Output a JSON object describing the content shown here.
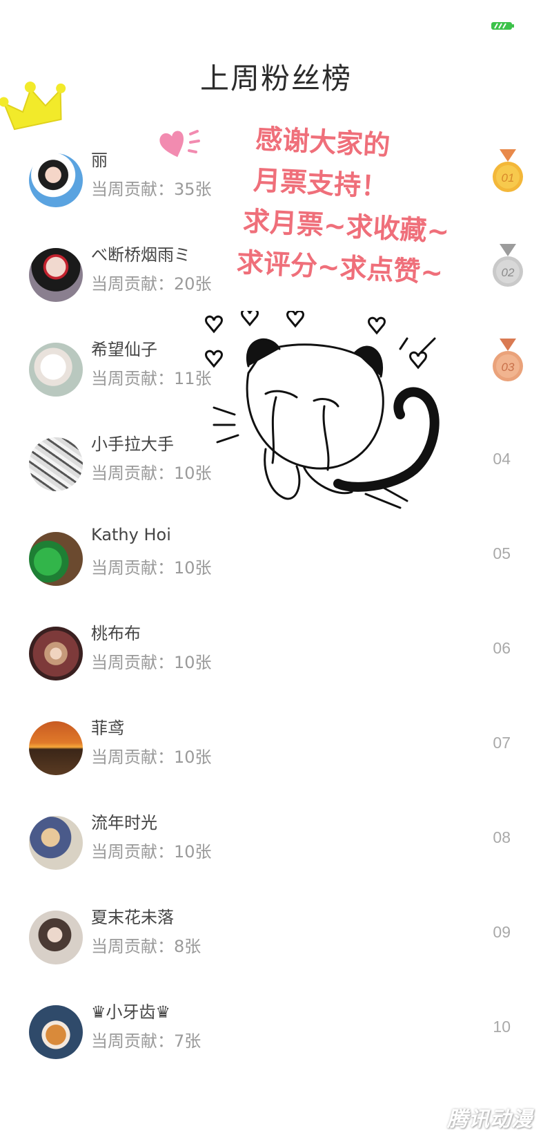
{
  "title": "上周粉丝榜",
  "thanks_message": [
    "感谢大家的",
    "月票支持！",
    "求月票~求收藏~",
    "求评分~求点赞~"
  ],
  "watermark": "腾讯动漫",
  "colors": {
    "accent_pink": "#ef6f7a",
    "gold": "#f3b739",
    "silver": "#c9c9c9",
    "bronze": "#eaa27a"
  },
  "fans": [
    {
      "name": "丽",
      "contribution": "当周贡献：35张",
      "rank": "01",
      "medal": "gold"
    },
    {
      "name": "べ断桥烟雨ミ",
      "contribution": "当周贡献：20张",
      "rank": "02",
      "medal": "silver"
    },
    {
      "name": "希望仙子",
      "contribution": "当周贡献：11张",
      "rank": "03",
      "medal": "bronze"
    },
    {
      "name": " 小手拉大手",
      "contribution": "当周贡献：10张",
      "rank": "04"
    },
    {
      "name": "Kathy Hoi",
      "contribution": "当周贡献：10张",
      "rank": "05"
    },
    {
      "name": "桃布布",
      "contribution": "当周贡献：10张",
      "rank": "06"
    },
    {
      "name": "菲鸢",
      "contribution": "当周贡献：10张",
      "rank": "07"
    },
    {
      "name": "流年时光",
      "contribution": "当周贡献：10张",
      "rank": "08"
    },
    {
      "name": "夏末花未落",
      "contribution": "当周贡献：8张",
      "rank": "09"
    },
    {
      "name": "♛小牙齿♛",
      "contribution": "当周贡献：7张",
      "rank": "10"
    }
  ]
}
